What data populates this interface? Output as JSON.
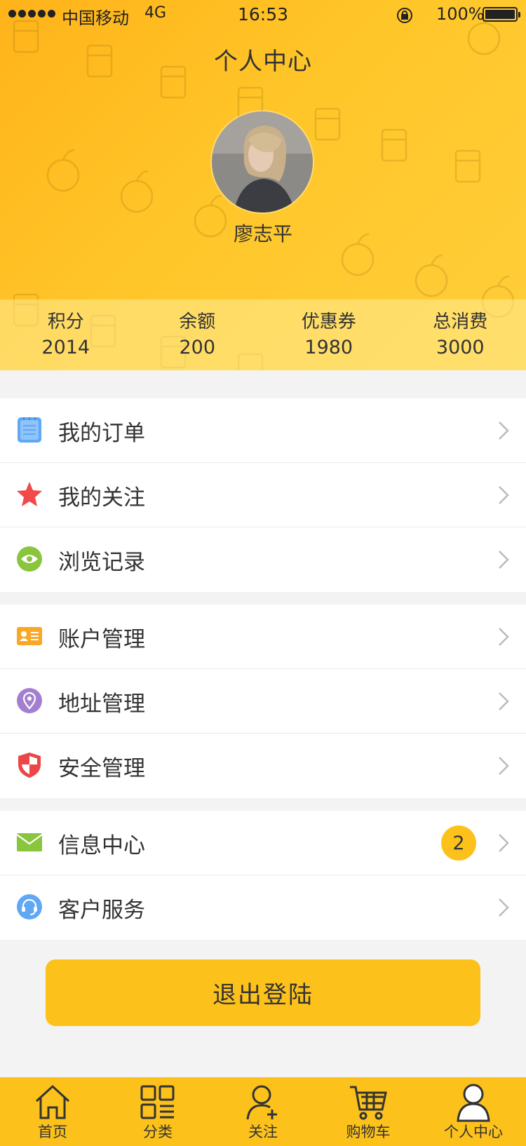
{
  "status_bar": {
    "carrier": "中国移动",
    "network": "4G",
    "time": "16:53",
    "battery": "100%"
  },
  "header": {
    "title": "个人中心",
    "username": "廖志平"
  },
  "stats": [
    {
      "label": "积分",
      "value": "2014"
    },
    {
      "label": "余额",
      "value": "200"
    },
    {
      "label": "优惠券",
      "value": "1980"
    },
    {
      "label": "总消费",
      "value": "3000"
    }
  ],
  "menu": {
    "group1": [
      {
        "label": "我的订单",
        "icon": "orders-icon",
        "color": "#5ea8f5"
      },
      {
        "label": "我的关注",
        "icon": "star-icon",
        "color": "#f2494a"
      },
      {
        "label": "浏览记录",
        "icon": "eye-icon",
        "color": "#8ac53e"
      }
    ],
    "group2": [
      {
        "label": "账户管理",
        "icon": "id-card-icon",
        "color": "#f9a825"
      },
      {
        "label": "地址管理",
        "icon": "location-pin-icon",
        "color": "#a47fd0"
      },
      {
        "label": "安全管理",
        "icon": "shield-icon",
        "color": "#ec4646"
      }
    ],
    "group3": [
      {
        "label": "信息中心",
        "icon": "mail-icon",
        "color": "#8ac53e",
        "badge": "2"
      },
      {
        "label": "客户服务",
        "icon": "headset-icon",
        "color": "#5ea8f5"
      }
    ]
  },
  "logout_label": "退出登陆",
  "tabbar": [
    {
      "label": "首页",
      "icon": "home-icon"
    },
    {
      "label": "分类",
      "icon": "category-grid-icon"
    },
    {
      "label": "关注",
      "icon": "add-user-icon"
    },
    {
      "label": "购物车",
      "icon": "cart-icon"
    },
    {
      "label": "个人中心",
      "icon": "profile-icon",
      "active": true
    }
  ],
  "colors": {
    "accent": "#fcc21b",
    "background": "#f3f3f3"
  }
}
